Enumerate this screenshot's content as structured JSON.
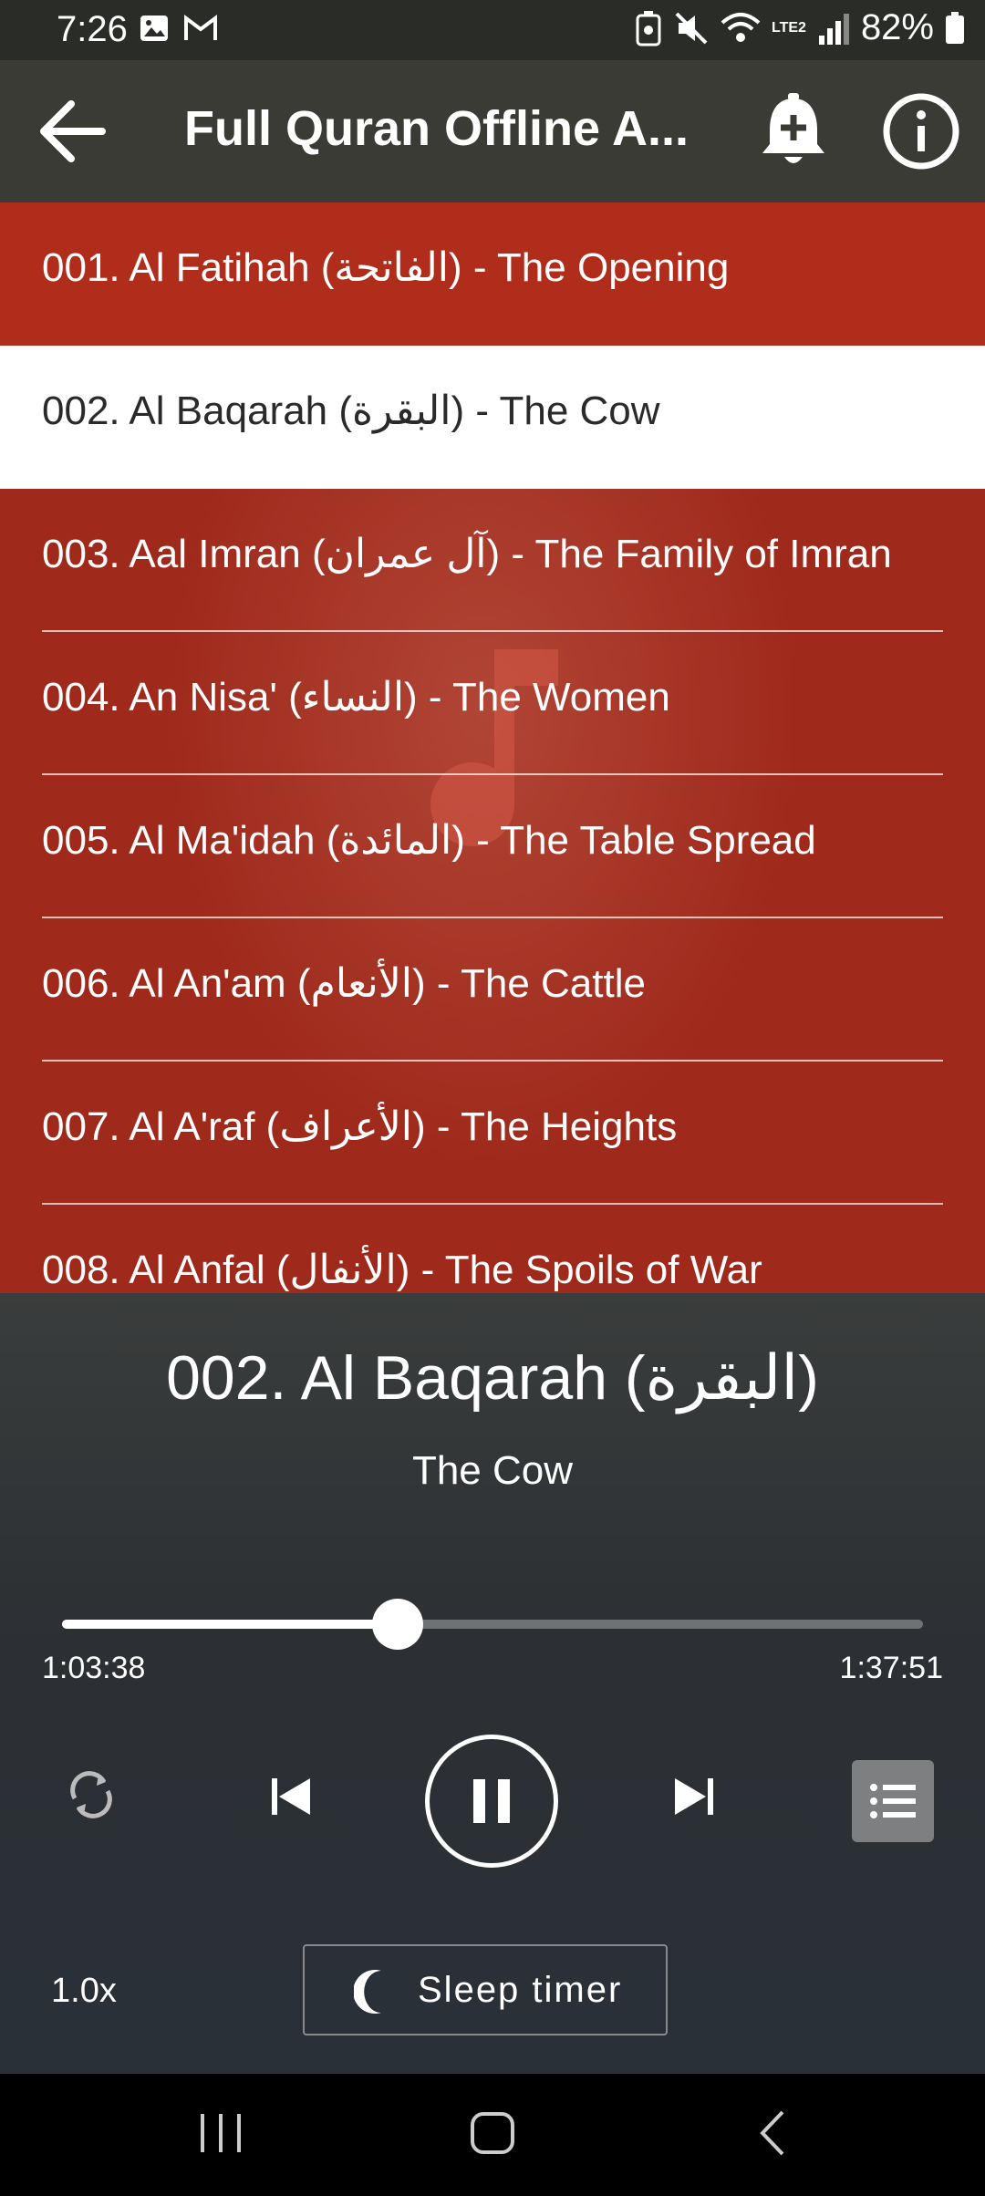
{
  "status_bar": {
    "time": "7:26",
    "battery": "82%",
    "network": "LTE2"
  },
  "app_bar": {
    "title": "Full Quran Offline A..."
  },
  "tracks": [
    {
      "label": "001. Al Fatihah (الفاتحة) - The Opening"
    },
    {
      "label": "002. Al Baqarah (البقرة) - The Cow"
    },
    {
      "label": "003. Aal Imran (آل عمران) - The Family of Imran"
    },
    {
      "label": "004. An Nisa' (النساء) - The Women"
    },
    {
      "label": "005. Al Ma'idah (المائدة) - The Table Spread"
    },
    {
      "label": "006. Al An'am (الأنعام) - The Cattle"
    },
    {
      "label": "007. Al A'raf (الأعراف) - The Heights"
    },
    {
      "label": "008. Al Anfal (الأنفال) - The Spoils of War"
    }
  ],
  "selected_track_index": 1,
  "player": {
    "title": "002. Al Baqarah (البقرة)",
    "subtitle": "The Cow",
    "current_time": "1:03:38",
    "duration": "1:37:51",
    "progress": 0.39,
    "speed": "1.0x",
    "sleep_timer_label": "Sleep timer"
  },
  "colors": {
    "list_bg": "#9f2a1c",
    "app_bar": "#3a3b35",
    "selected_row": "#ffffff",
    "accent_note": "#d65a4a"
  },
  "icons": {
    "back": "arrow-left-icon",
    "bell": "bell-plus-icon",
    "info": "info-icon",
    "repeat": "repeat-icon",
    "prev": "skip-previous-icon",
    "pause": "pause-icon",
    "next": "skip-next-icon",
    "playlist": "playlist-icon",
    "sleep": "moon-icon"
  }
}
